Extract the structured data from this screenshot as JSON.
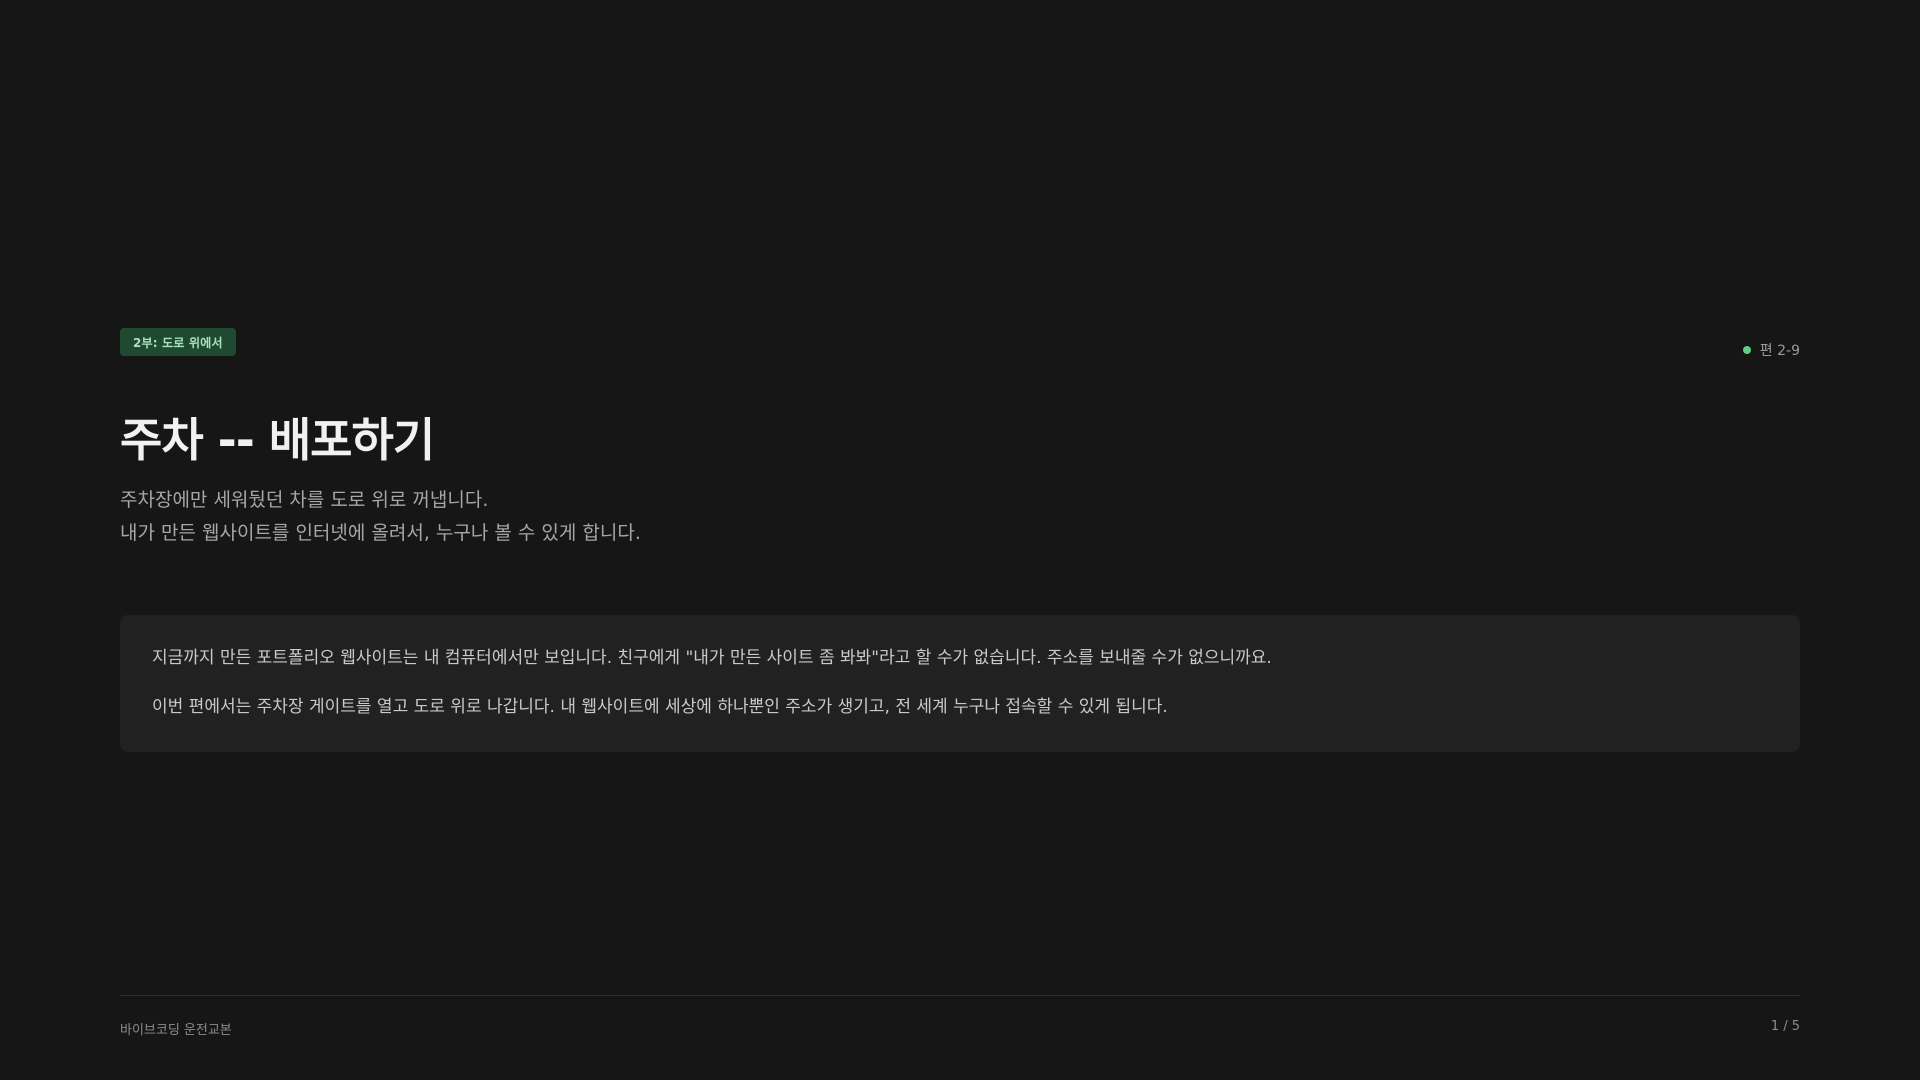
{
  "header": {
    "badge": "2부: 도로 위에서",
    "episode": "편 2-9",
    "episode_dot_color": "#5fcf86"
  },
  "title": "주차 -- 배포하기",
  "subtitle": [
    "주차장에만 세워뒀던 차를 도로 위로 꺼냅니다.",
    "내가 만든 웹사이트를 인터넷에 올려서, 누구나 볼 수 있게 합니다."
  ],
  "card": {
    "paragraphs": [
      "지금까지 만든 포트폴리오 웹사이트는 내 컴퓨터에서만 보입니다. 친구에게 \"내가 만든 사이트 좀 봐봐\"라고 할 수가 없습니다. 주소를 보내줄 수가 없으니까요.",
      "이번 편에서는 주차장 게이트를 열고 도로 위로 나갑니다. 내 웹사이트에 세상에 하나뿐인 주소가 생기고, 전 세계 누구나 접속할 수 있게 됩니다."
    ]
  },
  "footer": {
    "book_title": "바이브코딩 운전교본",
    "page_indicator": "1 / 5"
  },
  "colors": {
    "background": "#161616",
    "card": "#212121",
    "badge_bg": "#1f4a31",
    "badge_text": "#a9e2bd"
  }
}
